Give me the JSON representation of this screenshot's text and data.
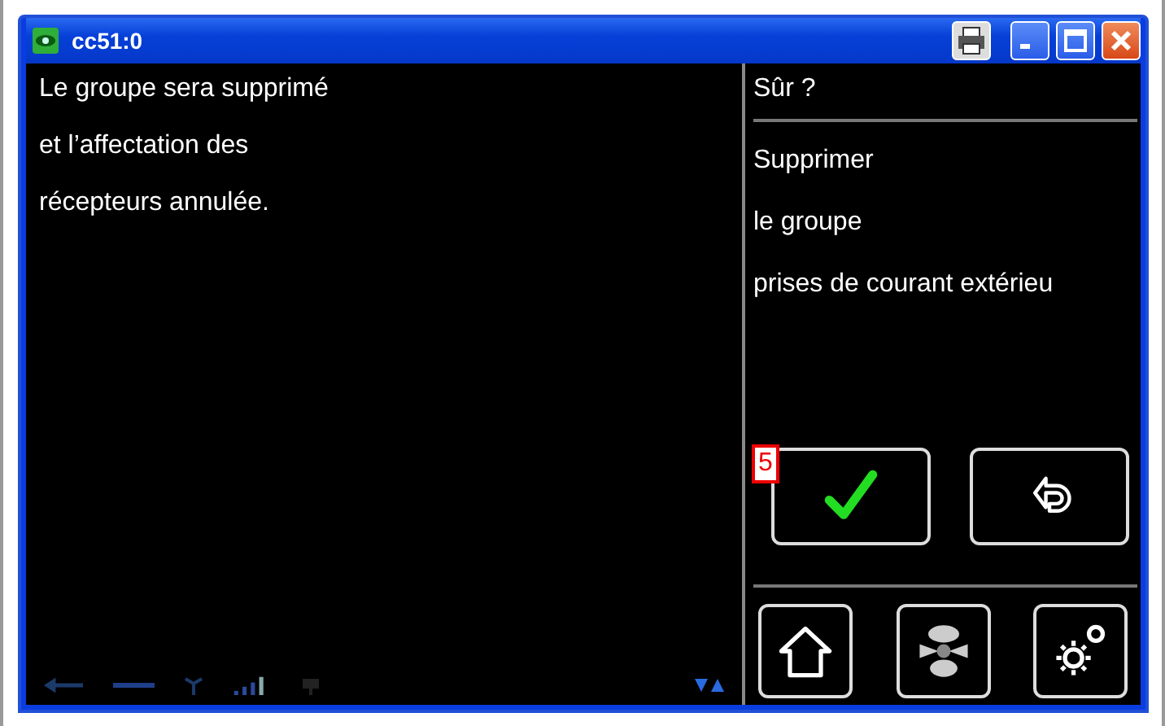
{
  "window": {
    "title": "cc51:0"
  },
  "message": {
    "lines": [
      "Le groupe sera supprimé",
      "et l’affectation des",
      "récepteurs annulée."
    ]
  },
  "confirm_panel": {
    "title": "Sûr ?",
    "lines": [
      "Supprimer",
      "le groupe",
      "prises de courant extérieu"
    ]
  },
  "actions": [
    {
      "kind": "confirm",
      "badge": "5"
    },
    {
      "kind": "back"
    }
  ],
  "nav_buttons": [
    {
      "kind": "home"
    },
    {
      "kind": "fan"
    },
    {
      "kind": "settings"
    }
  ]
}
